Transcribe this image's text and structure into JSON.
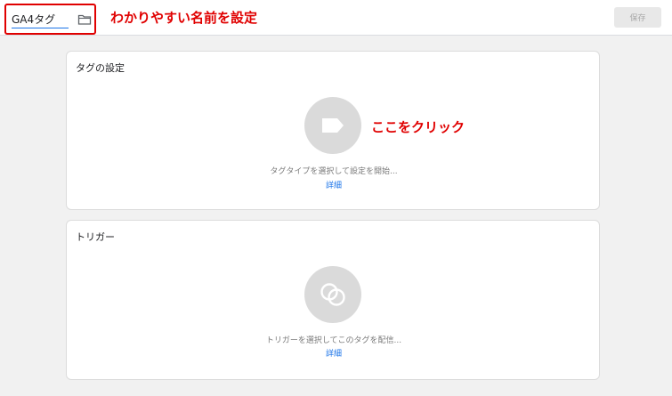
{
  "header": {
    "tag_name_value": "GA4タグ",
    "annotation_name": "わかりやすい名前を設定",
    "save_label": "保存"
  },
  "tag_config": {
    "title": "タグの設定",
    "annotation_click": "ここをクリック",
    "hint": "タグタイプを選択して設定を開始...",
    "detail_link": "詳細"
  },
  "trigger": {
    "title": "トリガー",
    "hint": "トリガーを選択してこのタグを配信...",
    "detail_link": "詳細"
  },
  "colors": {
    "annotation_red": "#e00000",
    "link_blue": "#1a73e8",
    "placeholder_circle": "#dadada"
  }
}
